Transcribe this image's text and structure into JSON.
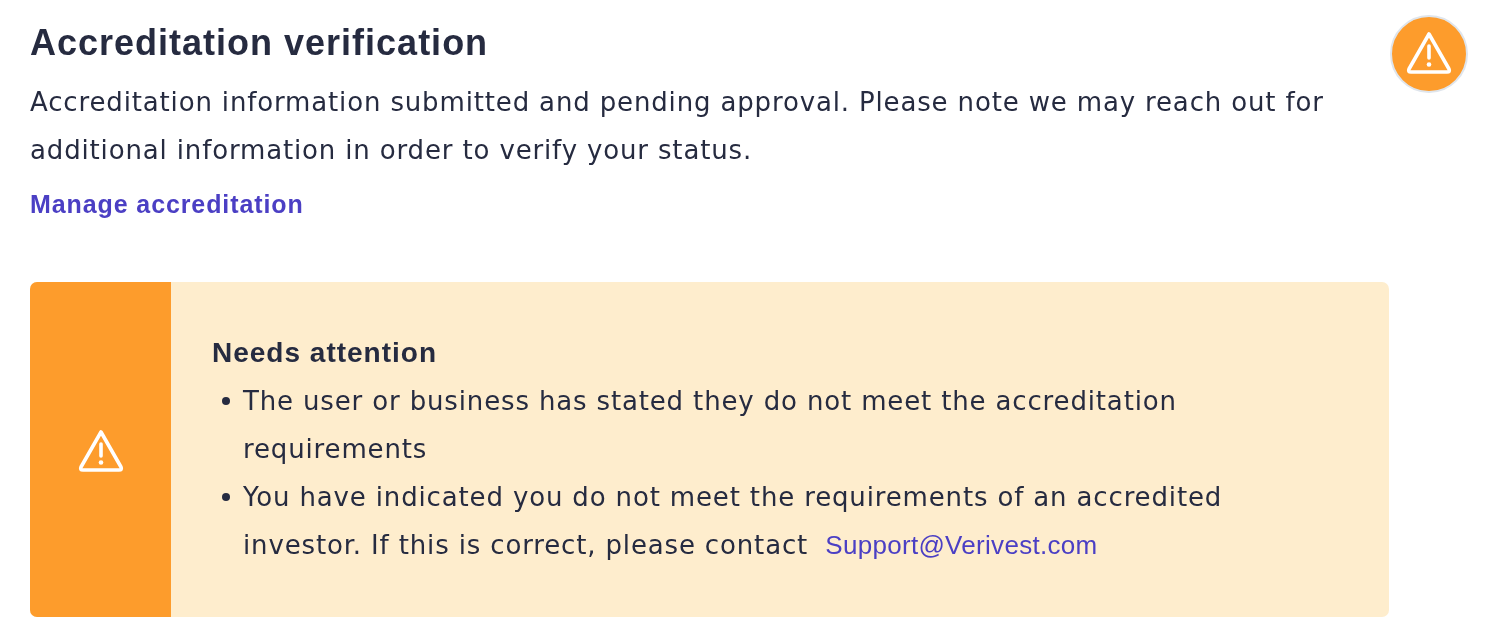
{
  "header": {
    "title": "Accreditation verification",
    "description": "Accreditation information submitted and pending approval. Please note we may reach out for additional information in order to verify your status.",
    "link": "Manage accreditation"
  },
  "alert": {
    "title": "Needs attention",
    "items": [
      {
        "text": "The user or business has stated they do not meet the accreditation requirements"
      },
      {
        "text": "You have indicated you do not meet the requirements of an accredited investor. If this is correct, please contact",
        "link": "Support@Verivest.com"
      }
    ]
  }
}
